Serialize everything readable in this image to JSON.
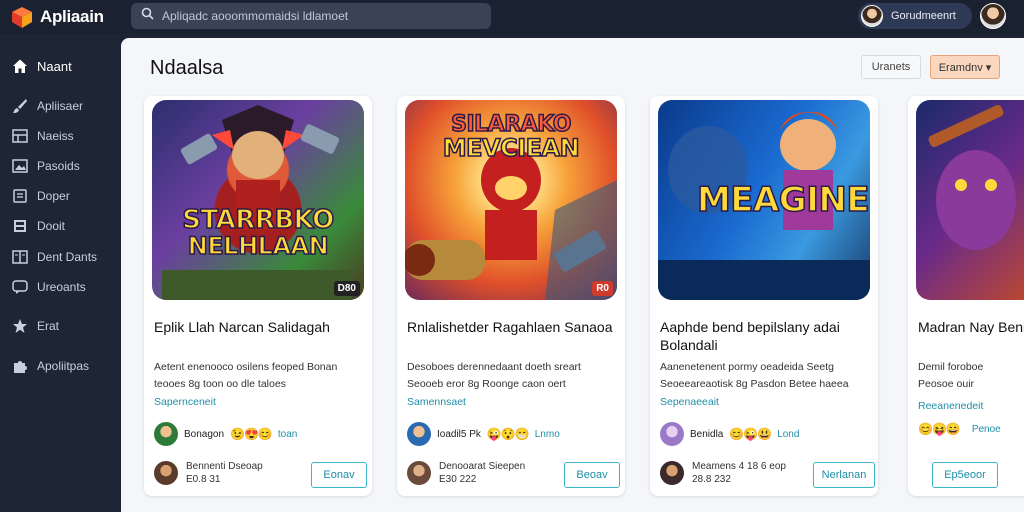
{
  "app": {
    "name": "Apliaain",
    "search_placeholder": "Apliqadc aooommomaidsi ldlamoet",
    "user_name": "Gorudmeenrt"
  },
  "sidebar": {
    "items": [
      {
        "label": "Naant",
        "icon": "home-icon",
        "active": true
      },
      {
        "label": "Apliisaer",
        "icon": "paint-brush-icon"
      },
      {
        "label": "Naeiss",
        "icon": "grid-icon"
      },
      {
        "label": "Pasoids",
        "icon": "image-icon"
      },
      {
        "label": "Doper",
        "icon": "folder-icon"
      },
      {
        "label": "Dooit",
        "icon": "document-icon"
      },
      {
        "label": "Dent Dants",
        "icon": "book-icon"
      },
      {
        "label": "Ureoants",
        "icon": "chat-icon"
      },
      {
        "label": "Erat",
        "icon": "star-icon"
      },
      {
        "label": "Apoliitpas",
        "icon": "puzzle-icon"
      }
    ]
  },
  "main": {
    "title": "Ndaalsa",
    "filter_label": "Uranets",
    "sort_label": "Eramdnv"
  },
  "cards": [
    {
      "thumb_title_1": "STARRBKO",
      "thumb_title_2": "NELHLAAN",
      "tag": "D80",
      "title": "Eplik Llah Narcan Salidagah",
      "desc": "Aetent enenooco osilens feoped Bonan teooes 8g toon oo dle taloes",
      "link": "Sapernceneit",
      "author": "Bonagon",
      "emojis": "😉😍😊",
      "ago": "toan",
      "meta_line1": "Bennenti Dseoap",
      "meta_line2": "E0.8 31",
      "button": "Eonav"
    },
    {
      "thumb_title_1": "SILARAKO",
      "thumb_title_2": "MEVCIEAN",
      "tag": "R0",
      "title": "Rnlalishetder Ragahlaen Sanaoa",
      "desc": "Desoboes derennedaant doeth sreart Seooeb eror 8g Roonge caon oert",
      "link": "Samennsaet",
      "author": "Ioadil5 Pk",
      "emojis": "😜😯😁",
      "ago": "Lnmo",
      "meta_line1": "Denooarat Sieepen",
      "meta_line2": "E30 222",
      "button": "Beoav"
    },
    {
      "thumb_title_1": "",
      "thumb_title_2": "MEAGINE",
      "tag": "",
      "title": "Aaphde bend bepilslany adai Bolandali",
      "desc": "Aanenetenent pormy oeadeida Seetg Seoeeareaotisk 8g Pasdon Betee haeea",
      "link": "Sepenaeeait",
      "author": "Benidla",
      "emojis": "😊😜😃",
      "ago": "Lond",
      "meta_line1": "Meamens 4 18 6 eop",
      "meta_line2": "28.8 232",
      "button": "Nerlanan"
    },
    {
      "thumb_title_1": "",
      "thumb_title_2": "",
      "tag": "",
      "title": "Madran Nay Benioal",
      "desc": "Demil foroboe Peosoe ouir",
      "link": "Reeanenedeit",
      "author": "",
      "emojis": "😊😝😄",
      "ago": "Penoe",
      "meta_line1": "",
      "meta_line2": "",
      "button": "Ep5eoor"
    }
  ]
}
